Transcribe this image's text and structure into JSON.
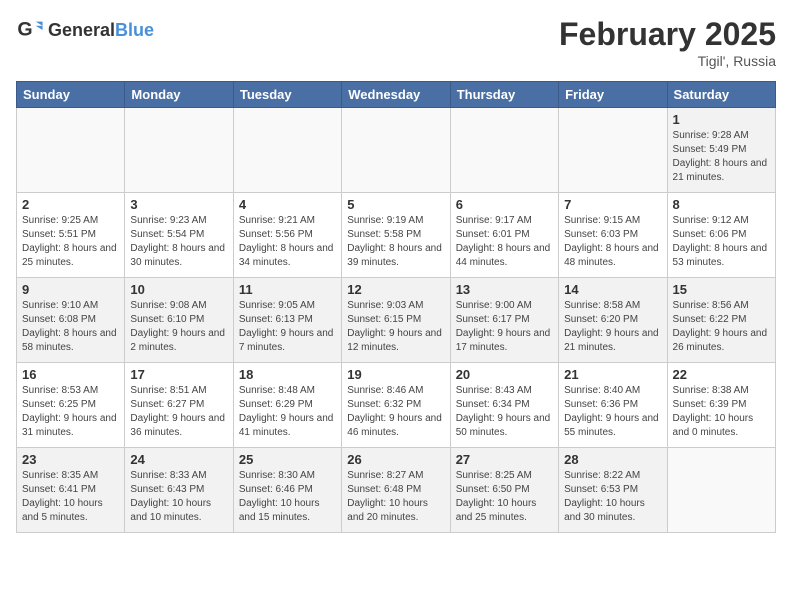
{
  "header": {
    "logo_general": "General",
    "logo_blue": "Blue",
    "month_title": "February 2025",
    "subtitle": "Tigil', Russia"
  },
  "weekdays": [
    "Sunday",
    "Monday",
    "Tuesday",
    "Wednesday",
    "Thursday",
    "Friday",
    "Saturday"
  ],
  "weeks": [
    [
      {
        "day": "",
        "info": ""
      },
      {
        "day": "",
        "info": ""
      },
      {
        "day": "",
        "info": ""
      },
      {
        "day": "",
        "info": ""
      },
      {
        "day": "",
        "info": ""
      },
      {
        "day": "",
        "info": ""
      },
      {
        "day": "1",
        "info": "Sunrise: 9:28 AM\nSunset: 5:49 PM\nDaylight: 8 hours and 21 minutes."
      }
    ],
    [
      {
        "day": "2",
        "info": "Sunrise: 9:25 AM\nSunset: 5:51 PM\nDaylight: 8 hours and 25 minutes."
      },
      {
        "day": "3",
        "info": "Sunrise: 9:23 AM\nSunset: 5:54 PM\nDaylight: 8 hours and 30 minutes."
      },
      {
        "day": "4",
        "info": "Sunrise: 9:21 AM\nSunset: 5:56 PM\nDaylight: 8 hours and 34 minutes."
      },
      {
        "day": "5",
        "info": "Sunrise: 9:19 AM\nSunset: 5:58 PM\nDaylight: 8 hours and 39 minutes."
      },
      {
        "day": "6",
        "info": "Sunrise: 9:17 AM\nSunset: 6:01 PM\nDaylight: 8 hours and 44 minutes."
      },
      {
        "day": "7",
        "info": "Sunrise: 9:15 AM\nSunset: 6:03 PM\nDaylight: 8 hours and 48 minutes."
      },
      {
        "day": "8",
        "info": "Sunrise: 9:12 AM\nSunset: 6:06 PM\nDaylight: 8 hours and 53 minutes."
      }
    ],
    [
      {
        "day": "9",
        "info": "Sunrise: 9:10 AM\nSunset: 6:08 PM\nDaylight: 8 hours and 58 minutes."
      },
      {
        "day": "10",
        "info": "Sunrise: 9:08 AM\nSunset: 6:10 PM\nDaylight: 9 hours and 2 minutes."
      },
      {
        "day": "11",
        "info": "Sunrise: 9:05 AM\nSunset: 6:13 PM\nDaylight: 9 hours and 7 minutes."
      },
      {
        "day": "12",
        "info": "Sunrise: 9:03 AM\nSunset: 6:15 PM\nDaylight: 9 hours and 12 minutes."
      },
      {
        "day": "13",
        "info": "Sunrise: 9:00 AM\nSunset: 6:17 PM\nDaylight: 9 hours and 17 minutes."
      },
      {
        "day": "14",
        "info": "Sunrise: 8:58 AM\nSunset: 6:20 PM\nDaylight: 9 hours and 21 minutes."
      },
      {
        "day": "15",
        "info": "Sunrise: 8:56 AM\nSunset: 6:22 PM\nDaylight: 9 hours and 26 minutes."
      }
    ],
    [
      {
        "day": "16",
        "info": "Sunrise: 8:53 AM\nSunset: 6:25 PM\nDaylight: 9 hours and 31 minutes."
      },
      {
        "day": "17",
        "info": "Sunrise: 8:51 AM\nSunset: 6:27 PM\nDaylight: 9 hours and 36 minutes."
      },
      {
        "day": "18",
        "info": "Sunrise: 8:48 AM\nSunset: 6:29 PM\nDaylight: 9 hours and 41 minutes."
      },
      {
        "day": "19",
        "info": "Sunrise: 8:46 AM\nSunset: 6:32 PM\nDaylight: 9 hours and 46 minutes."
      },
      {
        "day": "20",
        "info": "Sunrise: 8:43 AM\nSunset: 6:34 PM\nDaylight: 9 hours and 50 minutes."
      },
      {
        "day": "21",
        "info": "Sunrise: 8:40 AM\nSunset: 6:36 PM\nDaylight: 9 hours and 55 minutes."
      },
      {
        "day": "22",
        "info": "Sunrise: 8:38 AM\nSunset: 6:39 PM\nDaylight: 10 hours and 0 minutes."
      }
    ],
    [
      {
        "day": "23",
        "info": "Sunrise: 8:35 AM\nSunset: 6:41 PM\nDaylight: 10 hours and 5 minutes."
      },
      {
        "day": "24",
        "info": "Sunrise: 8:33 AM\nSunset: 6:43 PM\nDaylight: 10 hours and 10 minutes."
      },
      {
        "day": "25",
        "info": "Sunrise: 8:30 AM\nSunset: 6:46 PM\nDaylight: 10 hours and 15 minutes."
      },
      {
        "day": "26",
        "info": "Sunrise: 8:27 AM\nSunset: 6:48 PM\nDaylight: 10 hours and 20 minutes."
      },
      {
        "day": "27",
        "info": "Sunrise: 8:25 AM\nSunset: 6:50 PM\nDaylight: 10 hours and 25 minutes."
      },
      {
        "day": "28",
        "info": "Sunrise: 8:22 AM\nSunset: 6:53 PM\nDaylight: 10 hours and 30 minutes."
      },
      {
        "day": "",
        "info": ""
      }
    ]
  ]
}
